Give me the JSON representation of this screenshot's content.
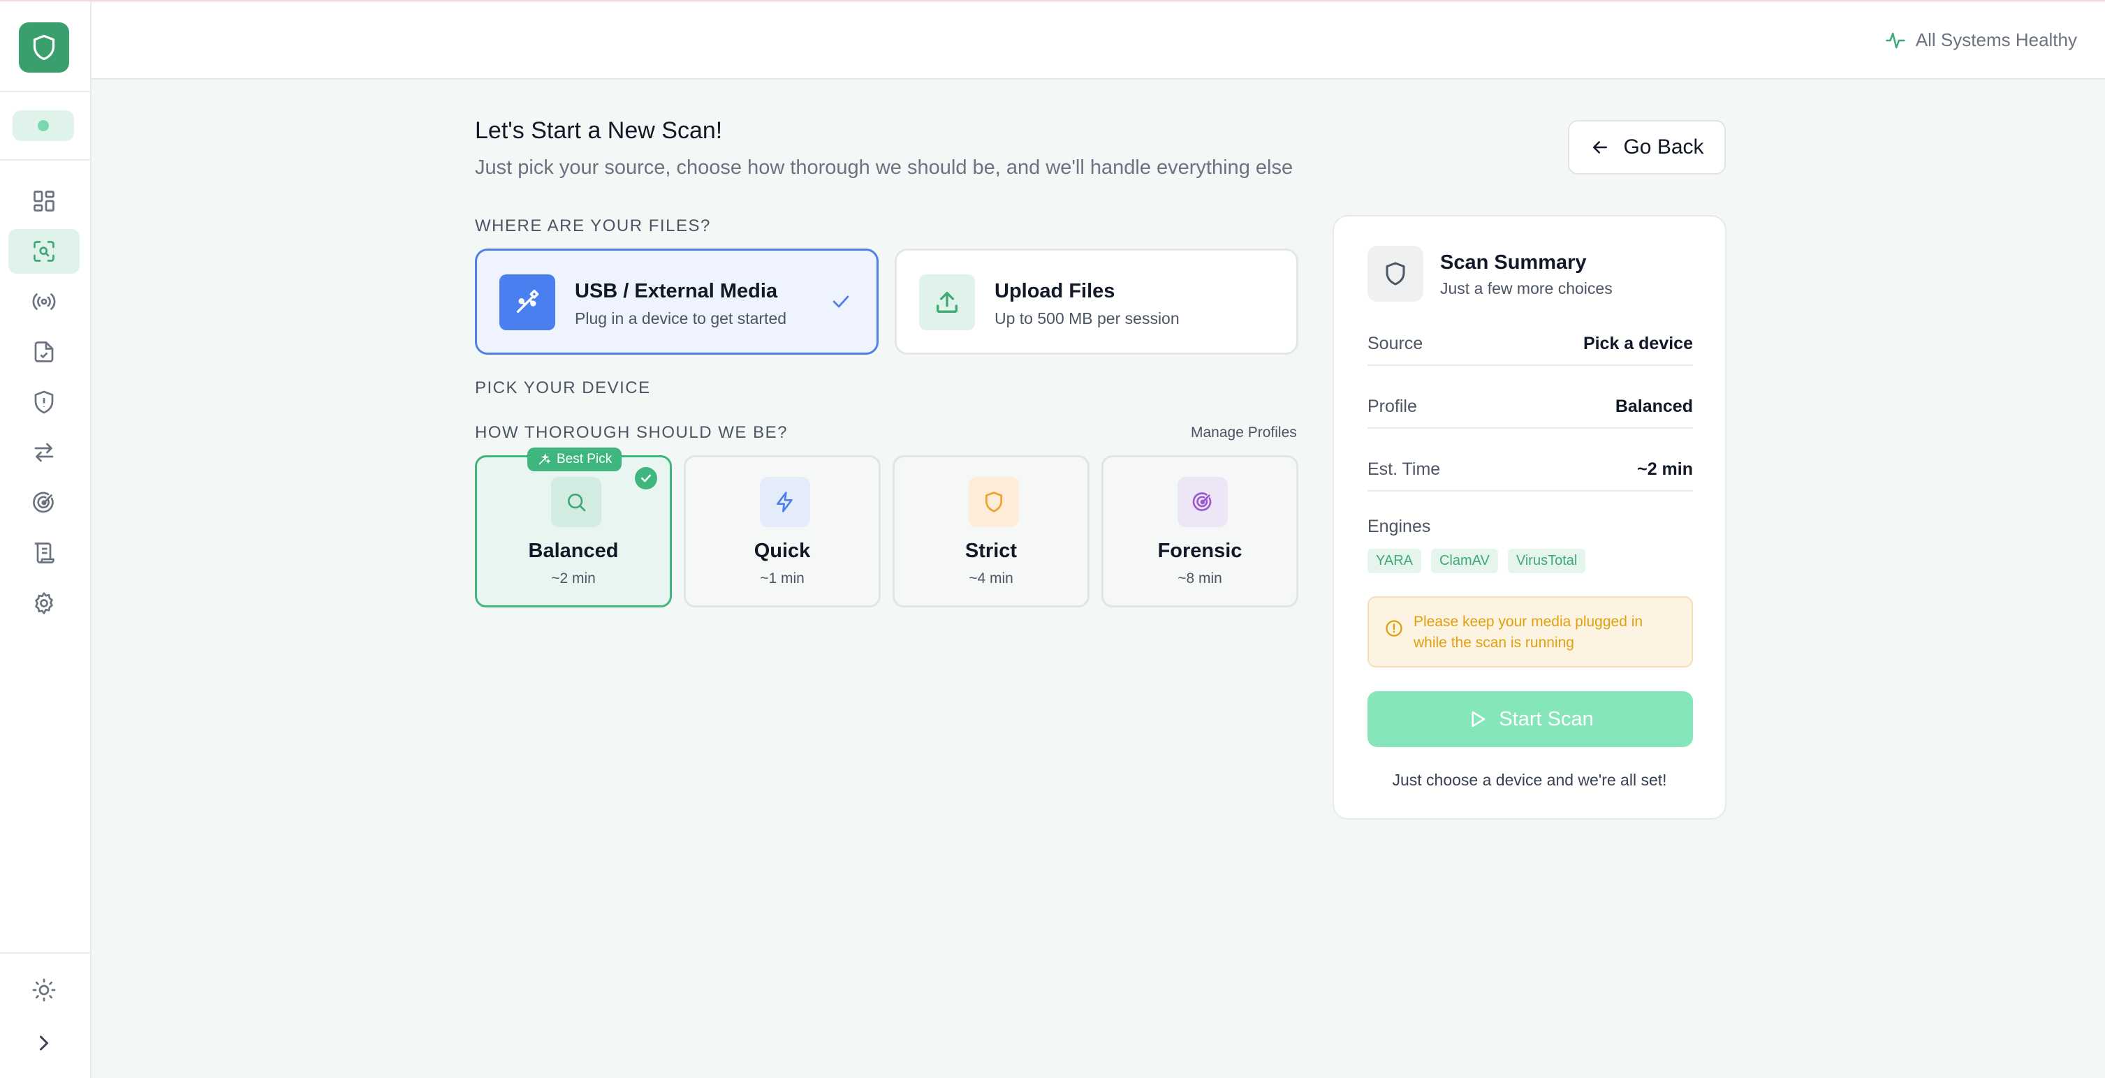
{
  "topbar": {
    "status": "All Systems Healthy"
  },
  "header": {
    "title": "Let's Start a New Scan!",
    "subtitle": "Just pick your source, choose how thorough we should be, and we'll handle everything else",
    "go_back": "Go Back"
  },
  "sections": {
    "files": "WHERE ARE YOUR FILES?",
    "device": "PICK YOUR DEVICE",
    "thoroughness": "HOW THOROUGH SHOULD WE BE?",
    "manage_profiles": "Manage Profiles"
  },
  "sources": [
    {
      "name": "USB / External Media",
      "desc": "Plug in a device to get started",
      "selected": true,
      "icon": "usb-icon"
    },
    {
      "name": "Upload Files",
      "desc": "Up to 500 MB per session",
      "selected": false,
      "icon": "upload-icon"
    }
  ],
  "profiles": [
    {
      "name": "Balanced",
      "time": "~2 min",
      "selected": true,
      "badge": "Best Pick",
      "icon": "search-icon"
    },
    {
      "name": "Quick",
      "time": "~1 min",
      "selected": false,
      "icon": "lightning-icon"
    },
    {
      "name": "Strict",
      "time": "~4 min",
      "selected": false,
      "icon": "shield-icon"
    },
    {
      "name": "Forensic",
      "time": "~8 min",
      "selected": false,
      "icon": "radar-icon"
    }
  ],
  "summary": {
    "title": "Scan Summary",
    "subtitle": "Just a few more choices",
    "rows": [
      {
        "key": "Source",
        "value": "Pick a device"
      },
      {
        "key": "Profile",
        "value": "Balanced"
      },
      {
        "key": "Est. Time",
        "value": "~2 min"
      }
    ],
    "engines_label": "Engines",
    "engines": [
      "YARA",
      "ClamAV",
      "VirusTotal"
    ],
    "warning": "Please keep your media plugged in while the scan is running",
    "start_button": "Start Scan",
    "footer": "Just choose a device and we're all set!"
  },
  "colors": {
    "brand": "#3a9f6d",
    "selected_source_border": "#4d80ea",
    "selected_profile_border": "#3fb67d",
    "start_button": "#85e6b9",
    "warning_text": "#e0a010"
  },
  "sidebar": {
    "nav_icons": [
      "dashboard-icon",
      "scan-icon",
      "broadcast-icon",
      "file-check-icon",
      "shield-alert-icon",
      "transfer-icon",
      "radar-icon",
      "scroll-icon",
      "gear-icon"
    ],
    "active": "scan-icon",
    "bottom_icons": [
      "sun-icon",
      "chevron-right-icon"
    ]
  }
}
